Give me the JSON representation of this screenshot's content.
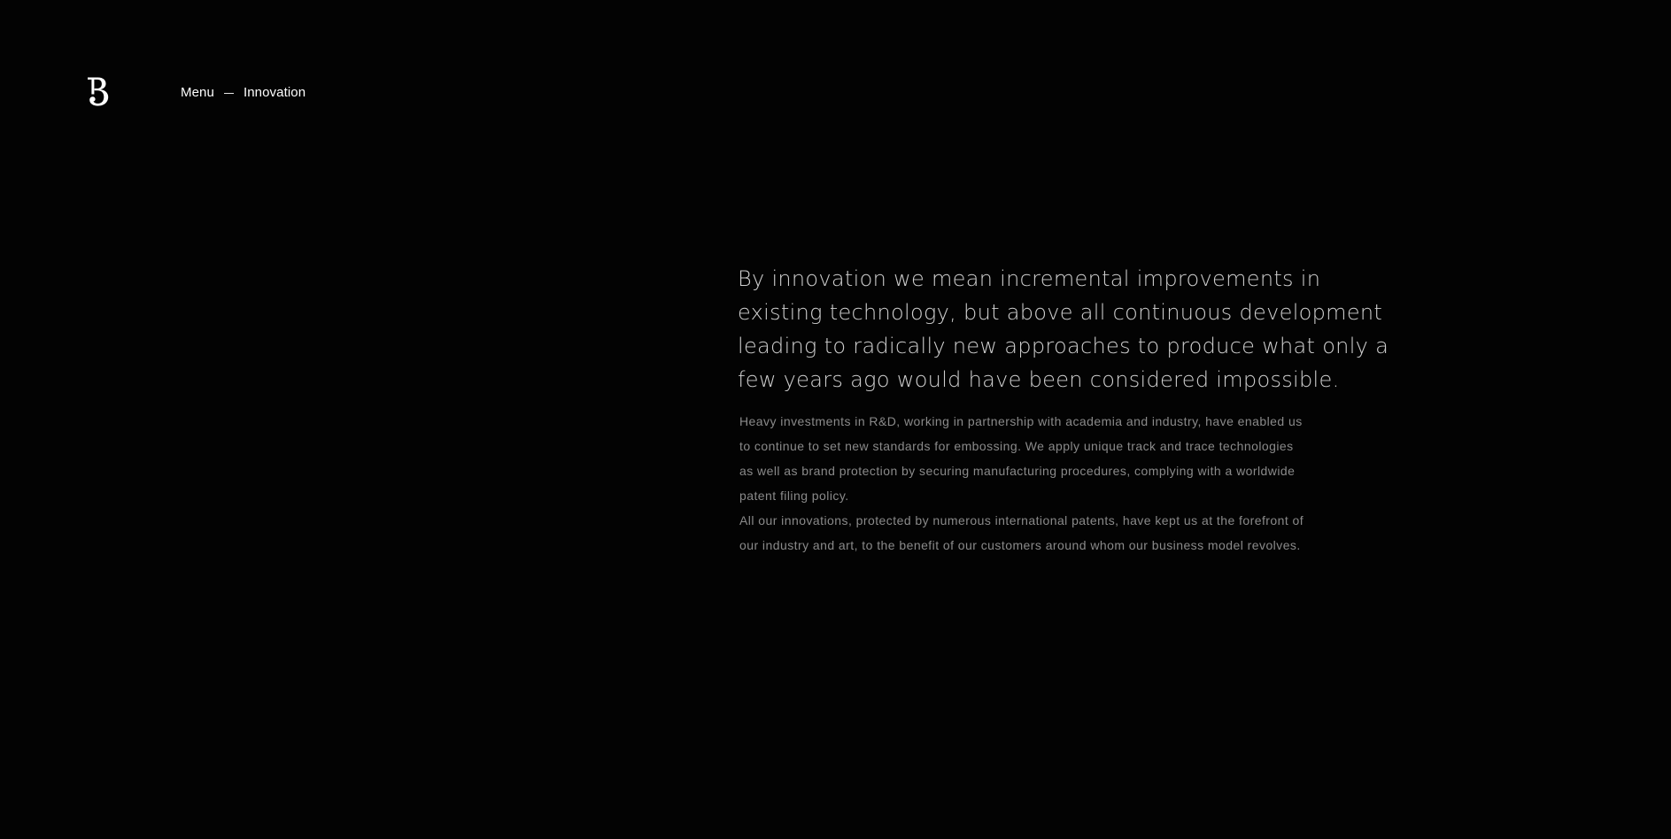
{
  "header": {
    "logo_icon": "brand-monogram-icon",
    "nav": {
      "menu_label": "Menu",
      "separator": "—",
      "current_page": "Innovation"
    }
  },
  "main": {
    "lead": "By innovation we mean incremental improvements in existing technology, but above all continuous development leading to radically new approaches to produce what only a few years ago would have been considered impossible.",
    "paragraphs": [
      "Heavy investments in R&D, working in partnership with academia and industry, have enabled us to continue to set new standards for embossing. We apply unique track and trace technologies as well as brand protection by securing manufacturing procedures, complying with a worldwide patent filing policy.",
      "All our innovations, protected by numerous international patents, have kept us at the forefront of our industry and art, to the benefit of our customers around whom our business model revolves."
    ]
  },
  "colors": {
    "background": "#030303",
    "nav_text": "#ffffff",
    "lead_text": "#cfcfcf",
    "body_text": "#8a8a8a"
  }
}
